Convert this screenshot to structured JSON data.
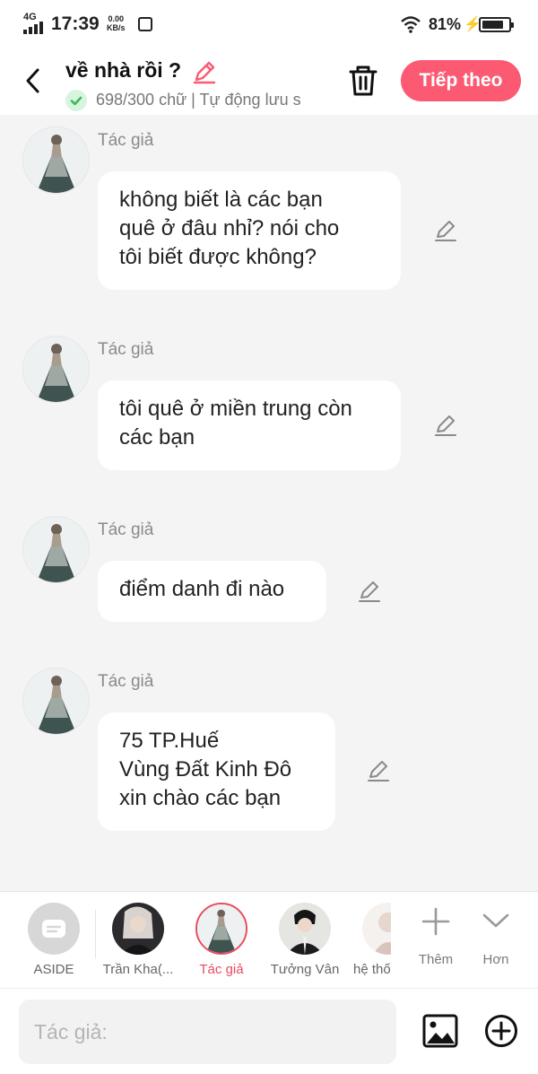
{
  "status_bar": {
    "network": "4G",
    "time": "17:39",
    "speed_value": "0.00",
    "speed_unit": "KB/s",
    "battery_percent": "81%",
    "battery_level": 0.81
  },
  "header": {
    "title": "về nhà rồi ?",
    "subtitle": "698/300 chữ | Tự động lưu s",
    "next_label": "Tiếp theo",
    "accent_color": "#fb5a72"
  },
  "messages": [
    {
      "author": "Tác giả",
      "lines": [
        "không biết là các bạn",
        "quê ở đâu nhỉ? nói cho",
        "tôi biết được không?"
      ]
    },
    {
      "author": "Tác giả",
      "lines": [
        "tôi quê ở miền trung còn",
        "các bạn"
      ]
    },
    {
      "author": "Tác giả",
      "lines": [
        "điểm danh đi nào"
      ]
    },
    {
      "author": "Tác giả",
      "lines": [
        "75 TP.Huế",
        "Vùng Đất Kinh Đô",
        "xin chào các bạn"
      ]
    }
  ],
  "characters": [
    {
      "label": "ASIDE"
    },
    {
      "label": "Trần Kha(..."
    },
    {
      "label": "Tác giả",
      "selected": true
    },
    {
      "label": "Tưởng Vân"
    },
    {
      "label": "hệ thố"
    }
  ],
  "actions": {
    "more_label": "Thêm",
    "expand_label": "Hơn"
  },
  "input": {
    "placeholder": "Tác giả:"
  }
}
